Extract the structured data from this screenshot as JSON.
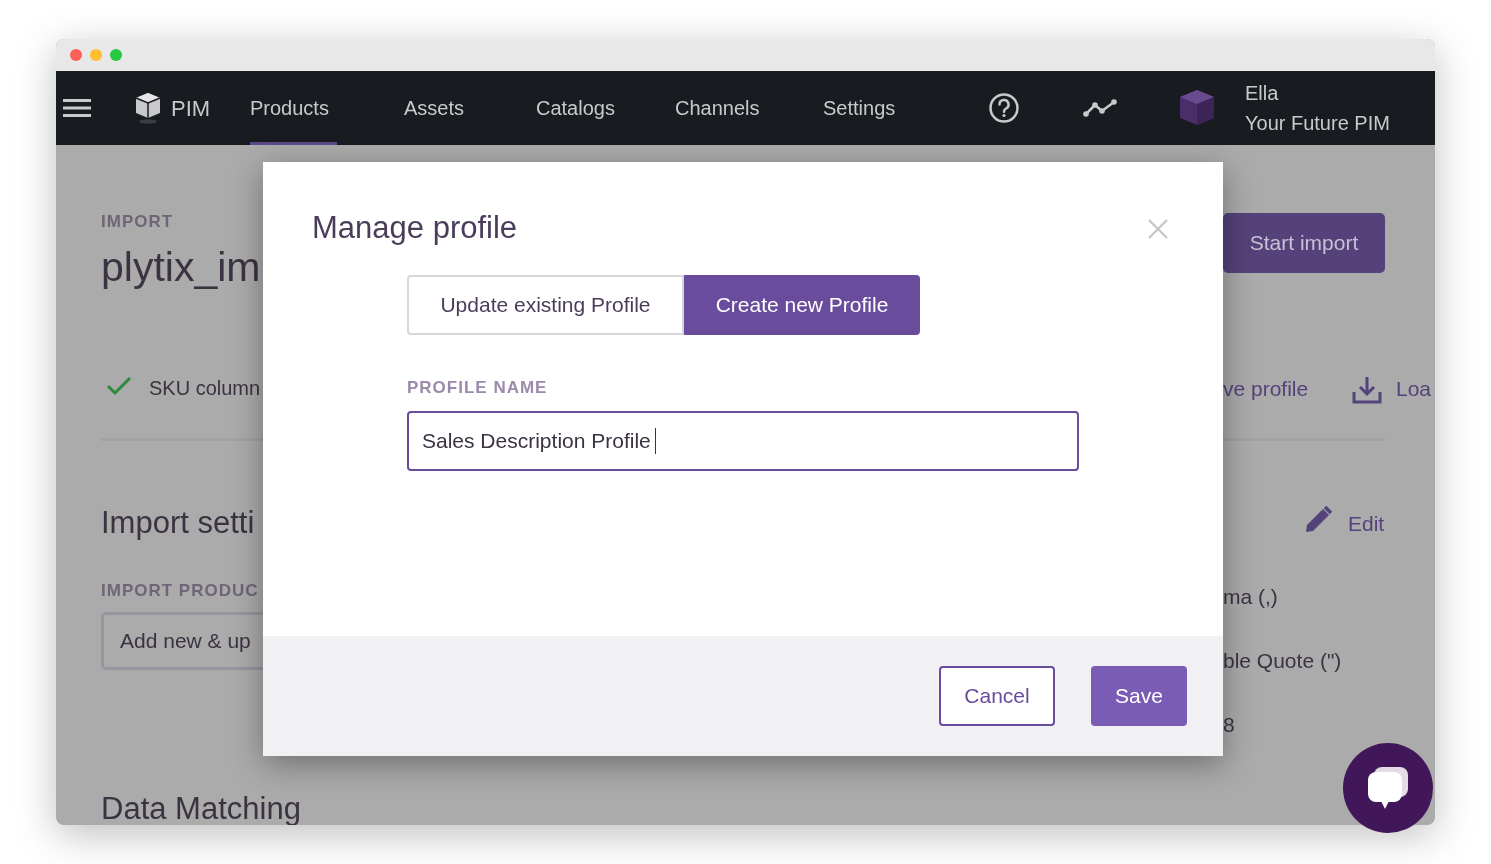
{
  "nav": {
    "brand": "PIM",
    "items": [
      {
        "label": "Products",
        "selected": true
      },
      {
        "label": "Assets",
        "selected": false
      },
      {
        "label": "Catalogs",
        "selected": false
      },
      {
        "label": "Channels",
        "selected": false
      },
      {
        "label": "Settings",
        "selected": false
      }
    ],
    "user": {
      "name": "Ella",
      "org": "Your Future PIM"
    }
  },
  "page": {
    "eyebrow": "IMPORT",
    "title": "plytix_im",
    "start_button": "Start import",
    "check": "SKU column",
    "save_profile": "ve profile",
    "load_profile": "Loa",
    "section_title": "Import setti",
    "edit": "Edit",
    "field_label": "IMPORT PRODUC",
    "field_value": "Add new & up",
    "separator": "ma (,)",
    "quote": "ble Quote (\")",
    "encoding": "8",
    "next_section": "Data Matching"
  },
  "modal": {
    "title": "Manage profile",
    "options": [
      {
        "label": "Update existing Profile",
        "selected": false
      },
      {
        "label": "Create new Profile",
        "selected": true
      }
    ],
    "field_label": "PROFILE NAME",
    "field_value": "Sales Description Profile",
    "buttons": [
      {
        "label": "Cancel",
        "kind": "secondary"
      },
      {
        "label": "Save",
        "kind": "primary"
      }
    ]
  }
}
